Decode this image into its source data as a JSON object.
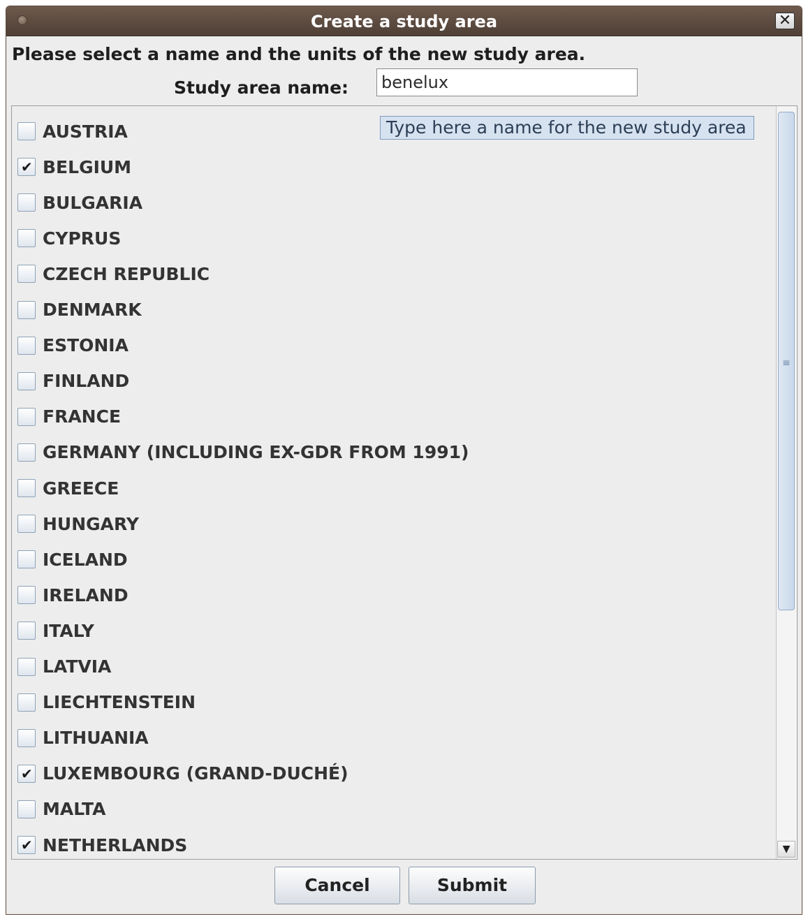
{
  "window": {
    "title": "Create a study area",
    "close_glyph": "✕"
  },
  "form": {
    "instruction": "Please select a name and the units of the new study area.",
    "name_label": "Study area name:",
    "name_value": "benelux",
    "tooltip": "Type here a name for the new study area"
  },
  "countries": [
    {
      "label": "AUSTRIA",
      "checked": false
    },
    {
      "label": "BELGIUM",
      "checked": true
    },
    {
      "label": "BULGARIA",
      "checked": false
    },
    {
      "label": "CYPRUS",
      "checked": false
    },
    {
      "label": "CZECH REPUBLIC",
      "checked": false
    },
    {
      "label": "DENMARK",
      "checked": false
    },
    {
      "label": "ESTONIA",
      "checked": false
    },
    {
      "label": "FINLAND",
      "checked": false
    },
    {
      "label": "FRANCE",
      "checked": false
    },
    {
      "label": "GERMANY (INCLUDING EX-GDR FROM 1991)",
      "checked": false
    },
    {
      "label": "GREECE",
      "checked": false
    },
    {
      "label": "HUNGARY",
      "checked": false
    },
    {
      "label": "ICELAND",
      "checked": false
    },
    {
      "label": "IRELAND",
      "checked": false
    },
    {
      "label": "ITALY",
      "checked": false
    },
    {
      "label": "LATVIA",
      "checked": false
    },
    {
      "label": "LIECHTENSTEIN",
      "checked": false
    },
    {
      "label": "LITHUANIA",
      "checked": false
    },
    {
      "label": "LUXEMBOURG (GRAND-DUCHÉ)",
      "checked": true
    },
    {
      "label": "MALTA",
      "checked": false
    },
    {
      "label": "NETHERLANDS",
      "checked": true
    }
  ],
  "check_glyph": "✔",
  "buttons": {
    "cancel": "Cancel",
    "submit": "Submit"
  },
  "scrollbar": {
    "grip_glyph": "≡",
    "down_glyph": "▼"
  }
}
